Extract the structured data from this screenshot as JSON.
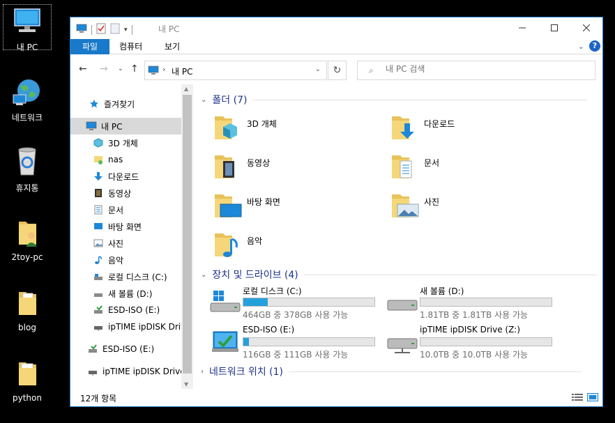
{
  "desktop": {
    "icons": [
      {
        "label": "내 PC"
      },
      {
        "label": "네트워크"
      },
      {
        "label": "휴지통"
      },
      {
        "label": "2toy-pc"
      },
      {
        "label": "blog"
      },
      {
        "label": "python"
      }
    ]
  },
  "window": {
    "title": "내 PC",
    "ribbon_tabs": [
      "파일",
      "컴퓨터",
      "보기"
    ],
    "address": "내 PC",
    "search_placeholder": "내 PC 검색"
  },
  "sidebar": {
    "items": [
      {
        "label": "즐겨찾기",
        "icon": "star-icon"
      },
      {
        "label": "내 PC",
        "icon": "pc-icon"
      },
      {
        "label": "3D 개체",
        "icon": "cube-icon"
      },
      {
        "label": "nas",
        "icon": "network-folder-icon"
      },
      {
        "label": "다운로드",
        "icon": "download-icon"
      },
      {
        "label": "동영상",
        "icon": "film-icon"
      },
      {
        "label": "문서",
        "icon": "document-icon"
      },
      {
        "label": "바탕 화면",
        "icon": "desktop-icon"
      },
      {
        "label": "사진",
        "icon": "picture-icon"
      },
      {
        "label": "음악",
        "icon": "music-icon"
      },
      {
        "label": "로컬 디스크 (C:)",
        "icon": "drive-icon"
      },
      {
        "label": "새 볼륨 (D:)",
        "icon": "drive-icon"
      },
      {
        "label": "ESD-ISO (E:)",
        "icon": "usb-drive-icon"
      },
      {
        "label": "ipTIME ipDISK Drive",
        "icon": "network-drive-icon"
      },
      {
        "label": "ESD-ISO (E:)",
        "icon": "usb-drive-icon"
      },
      {
        "label": "ipTIME ipDISK Drive (",
        "icon": "network-drive-icon"
      }
    ]
  },
  "content": {
    "folders_header": "폴더 (7)",
    "folders": [
      {
        "name": "3D 개체",
        "icon": "cube-icon"
      },
      {
        "name": "다운로드",
        "icon": "download-icon"
      },
      {
        "name": "동영상",
        "icon": "film-icon"
      },
      {
        "name": "문서",
        "icon": "document-icon"
      },
      {
        "name": "바탕 화면",
        "icon": "desktop-icon"
      },
      {
        "name": "사진",
        "icon": "picture-icon"
      },
      {
        "name": "음악",
        "icon": "music-icon"
      }
    ],
    "drives_header": "장치 및 드라이브 (4)",
    "drives": [
      {
        "name": "로컬 디스크 (C:)",
        "free": "464GB 중 378GB 사용 가능",
        "used_fraction": 0.185,
        "icon": "windows-drive-icon"
      },
      {
        "name": "새 볼륨 (D:)",
        "free": "1.81TB 중 1.81TB 사용 가능",
        "used_fraction": 0.0,
        "icon": "drive-icon"
      },
      {
        "name": "ESD-ISO (E:)",
        "free": "116GB 중 111GB 사용 가능",
        "used_fraction": 0.045,
        "icon": "usb-drive-icon"
      },
      {
        "name": "ipTIME ipDISK Drive (Z:)",
        "free": "10.0TB 중 10.0TB 사용 가능",
        "used_fraction": 0.0,
        "icon": "network-drive-icon"
      }
    ],
    "network_header": "네트워크 위치 (1)"
  },
  "status": {
    "item_count": "12개 항목"
  },
  "colors": {
    "accent": "#1979ca",
    "progress": "#26a0da",
    "group_header": "#1e3287"
  }
}
